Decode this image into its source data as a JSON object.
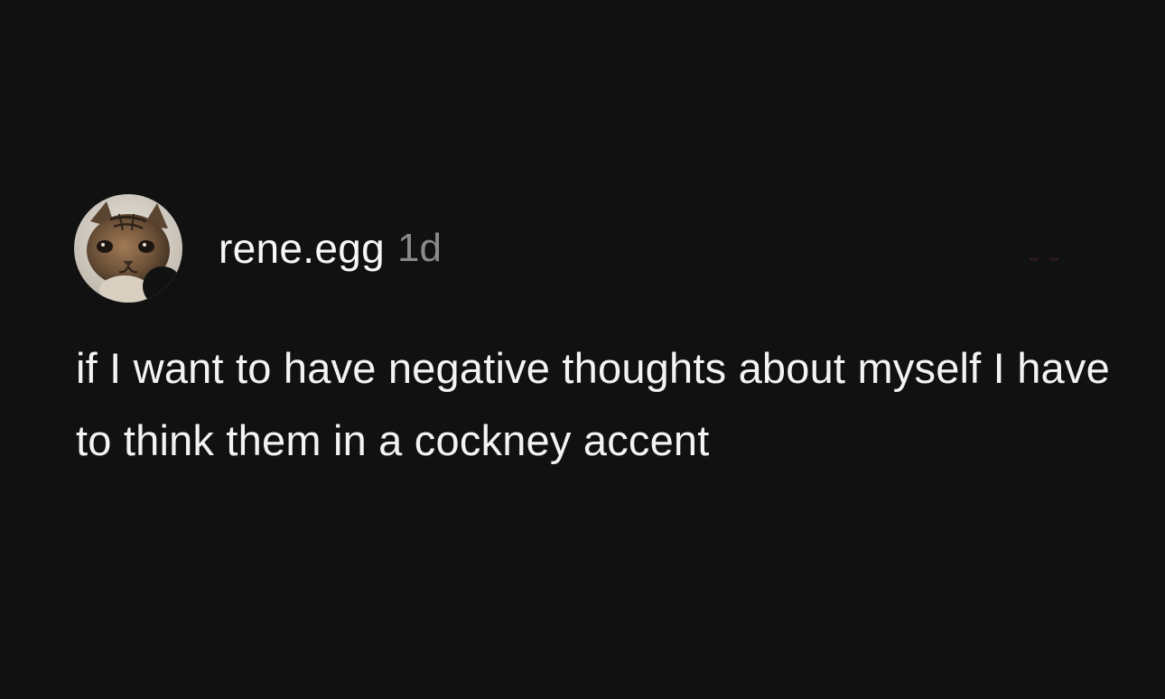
{
  "post": {
    "author": {
      "username": "rene.egg",
      "avatar_icon": "cat-avatar-icon"
    },
    "timestamp": "1d",
    "text": "if I want to have negative thoughts about myself I have to think them in a cockney accent"
  },
  "colors": {
    "background": "#111112",
    "text": "#f3f3f3",
    "muted": "#8a8a8a"
  }
}
